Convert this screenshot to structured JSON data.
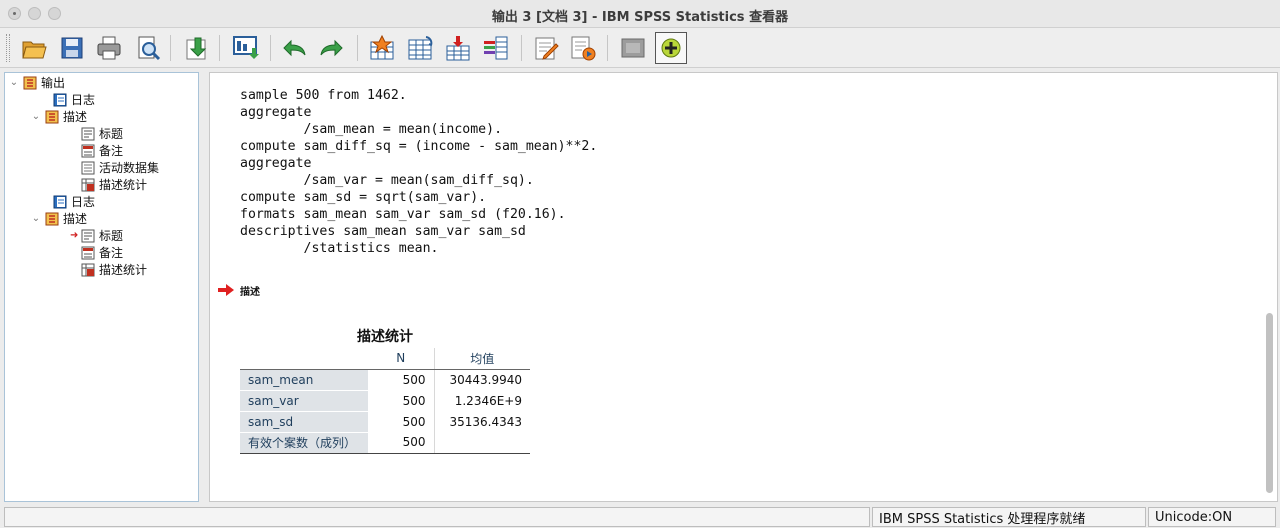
{
  "window": {
    "title": "输出 3 [文档 3] - IBM SPSS Statistics 查看器"
  },
  "toolbar": {
    "buttons": [
      "open-icon",
      "save-icon",
      "print-icon",
      "print-preview-icon",
      "export-icon",
      "recall-dialog-icon",
      "undo-icon",
      "redo-icon",
      "goto-case-icon",
      "goto-variable-icon",
      "insert-cases-icon",
      "variables-icon",
      "designate-window-icon",
      "run-script-icon",
      "hide-icon",
      "create-new-icon"
    ]
  },
  "tree": {
    "items": [
      {
        "label": "输出",
        "icon": "output-book-icon"
      },
      {
        "label": "日志",
        "icon": "log-icon"
      },
      {
        "label": "描述",
        "icon": "output-book-icon"
      },
      {
        "label": "标题",
        "icon": "title-icon"
      },
      {
        "label": "备注",
        "icon": "notes-icon"
      },
      {
        "label": "活动数据集",
        "icon": "dataset-icon"
      },
      {
        "label": "描述统计",
        "icon": "table-icon"
      },
      {
        "label": "日志",
        "icon": "log-icon"
      },
      {
        "label": "描述",
        "icon": "output-book-icon"
      },
      {
        "label": "标题",
        "icon": "title-icon"
      },
      {
        "label": "备注",
        "icon": "notes-icon"
      },
      {
        "label": "描述统计",
        "icon": "table-icon"
      }
    ]
  },
  "content": {
    "syntax": [
      "sample 500 from 1462.",
      "aggregate",
      "        /sam_mean = mean(income).",
      "compute sam_diff_sq = (income - sam_mean)**2.",
      "aggregate",
      "        /sam_var = mean(sam_diff_sq).",
      "compute sam_sd = sqrt(sam_var).",
      "formats sam_mean sam_var sam_sd (f20.16).",
      "descriptives sam_mean sam_var sam_sd",
      "        /statistics mean."
    ],
    "section_heading": "描述",
    "table": {
      "title": "描述统计",
      "columns": [
        "",
        "N",
        "均值"
      ],
      "rows": [
        {
          "label": "sam_mean",
          "n": "500",
          "mean": "30443.9940"
        },
        {
          "label": "sam_var",
          "n": "500",
          "mean": "1.2346E+9"
        },
        {
          "label": "sam_sd",
          "n": "500",
          "mean": "35136.4343"
        },
        {
          "label": "有效个案数（成列）",
          "n": "500",
          "mean": ""
        }
      ]
    }
  },
  "statusbar": {
    "processor": "IBM SPSS Statistics 处理程序就绪",
    "unicode": "Unicode:ON"
  }
}
